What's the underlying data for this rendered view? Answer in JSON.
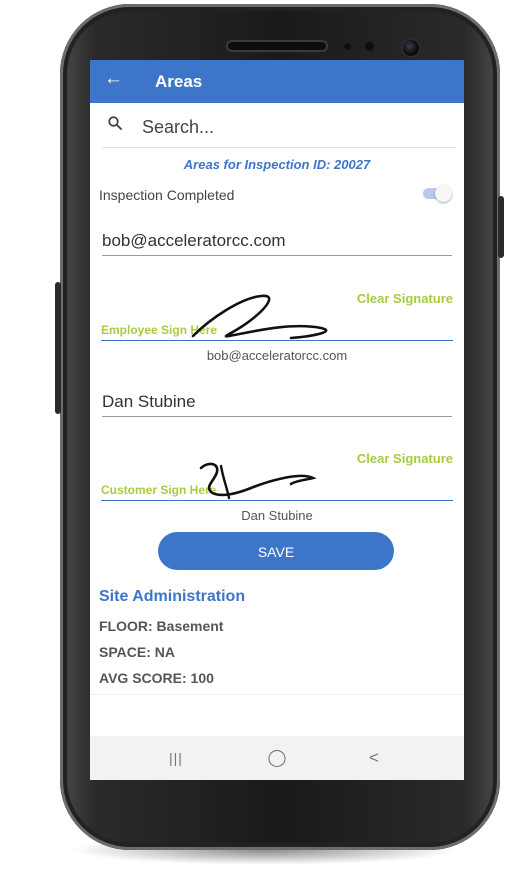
{
  "appbar": {
    "back_icon": "←",
    "title": "Areas"
  },
  "search": {
    "placeholder": "Search..."
  },
  "inspection": {
    "title": "Areas for Inspection ID: 20027",
    "completed_label": "Inspection Completed",
    "completed": true
  },
  "employee": {
    "email": "bob@acceleratorcc.com",
    "clear_label": "Clear Signature",
    "sign_label": "Employee Sign Here",
    "caption": "bob@acceleratorcc.com"
  },
  "customer": {
    "name": "Dan Stubine",
    "clear_label": "Clear Signature",
    "sign_label": "Customer Sign Here",
    "caption": "Dan Stubine"
  },
  "save_label": "SAVE",
  "site": {
    "title": "Site Administration",
    "floor": "FLOOR: Basement",
    "space": "SPACE: NA",
    "avg_score": "AVG SCORE: 100"
  },
  "navbar": {
    "recents_icon": "|||",
    "home_icon": "◯",
    "back_icon": "<"
  },
  "colors": {
    "accent": "#3d76c9",
    "signature_green": "#a8cc3c",
    "toggle_track": "#b8c9ea"
  }
}
